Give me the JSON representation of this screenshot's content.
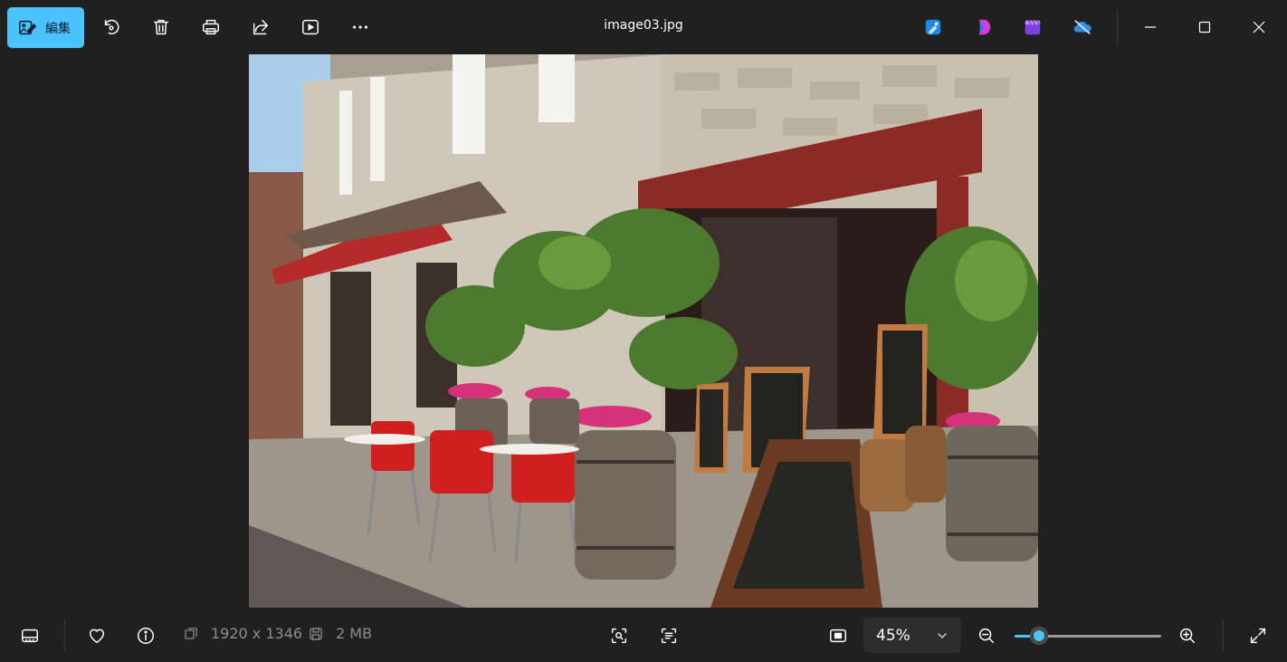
{
  "toolbar": {
    "edit_label": "編集",
    "title": "image03.jpg"
  },
  "icons": {
    "edit": "edit-photo-icon",
    "rotate": "rotate-icon",
    "delete": "trash-icon",
    "print": "print-icon",
    "share": "share-icon",
    "slideshow": "slideshow-icon",
    "more": "more-icon",
    "designer": "designer-icon",
    "copilot": "copilot-icon",
    "clipchamp": "clipchamp-icon",
    "onedrive": "onedrive-icon"
  },
  "status": {
    "dimensions": "1920 x 1346",
    "file_size": "2 MB",
    "zoom": "45%",
    "zoom_level": 0.12
  },
  "colors": {
    "accent": "#4cc2ff",
    "background": "#202020"
  }
}
